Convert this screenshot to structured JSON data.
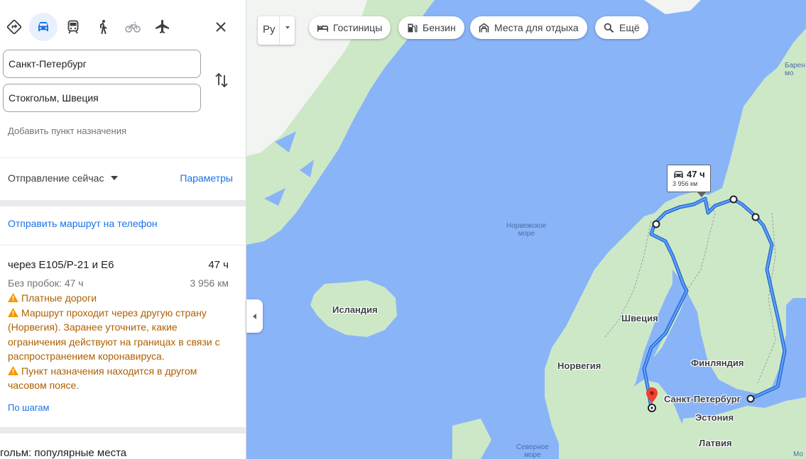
{
  "sidebar": {
    "modes": [
      {
        "name": "mode-best",
        "icon": "directions-diamond-icon",
        "active": false
      },
      {
        "name": "mode-driving",
        "icon": "car-icon",
        "active": true
      },
      {
        "name": "mode-transit",
        "icon": "train-icon",
        "active": false
      },
      {
        "name": "mode-walking",
        "icon": "walking-icon",
        "active": false
      },
      {
        "name": "mode-cycling",
        "icon": "bicycle-icon",
        "active": false
      },
      {
        "name": "mode-flight",
        "icon": "airplane-icon",
        "active": false
      }
    ],
    "close_icon": "close-icon",
    "origin": "Санкт-Петербург",
    "destination": "Стокгольм, Швеция",
    "add_destination": "Добавить пункт назначения",
    "depart_label": "Отправление сейчас",
    "params_label": "Параметры",
    "send_to_phone": "Отправить маршрут на телефон",
    "route": {
      "title": "через E105/Р-21 и E6",
      "duration": "47 ч",
      "traffic_note": "Без пробок: 47 ч",
      "distance": "3 956 км",
      "warnings": [
        "Платные дороги",
        "Маршрут проходит через другую страну (Норвегия). Заранее уточните, какие ограничения действуют на границах в связи с распространением коронавируса.",
        "Пункт назначения находится в другом часовом поясе."
      ],
      "steps_link": "По шагам"
    },
    "popular_places": "гольм: популярные места"
  },
  "map": {
    "layer_button": "Ру",
    "chips": [
      {
        "label": "Гостиницы",
        "icon": "hotel-bed-icon"
      },
      {
        "label": "Бензин",
        "icon": "gas-station-icon"
      },
      {
        "label": "Места для отдыха",
        "icon": "attractions-icon"
      },
      {
        "label": "Ещё",
        "icon": "search-icon"
      }
    ],
    "labels": {
      "iceland": "Исландия",
      "sweden": "Швеция",
      "norway": "Норвегия",
      "finland": "Финляндия",
      "estonia": "Эстония",
      "latvia": "Латвия",
      "spb": "Санкт-Петербург",
      "norwegian_sea_1": "Норвежское",
      "norwegian_sea_2": "море",
      "north_sea_1": "Северное",
      "north_sea_2": "море",
      "barents_1": "Барен",
      "barents_2": "мо",
      "edge_text": "Мо"
    },
    "route_box": {
      "duration": "47 ч",
      "distance": "3 956 км"
    },
    "colors": {
      "water": "#8ab4f8",
      "land": "#cde8c6",
      "route": "#1a73e8",
      "pin": "#ea4335"
    }
  }
}
